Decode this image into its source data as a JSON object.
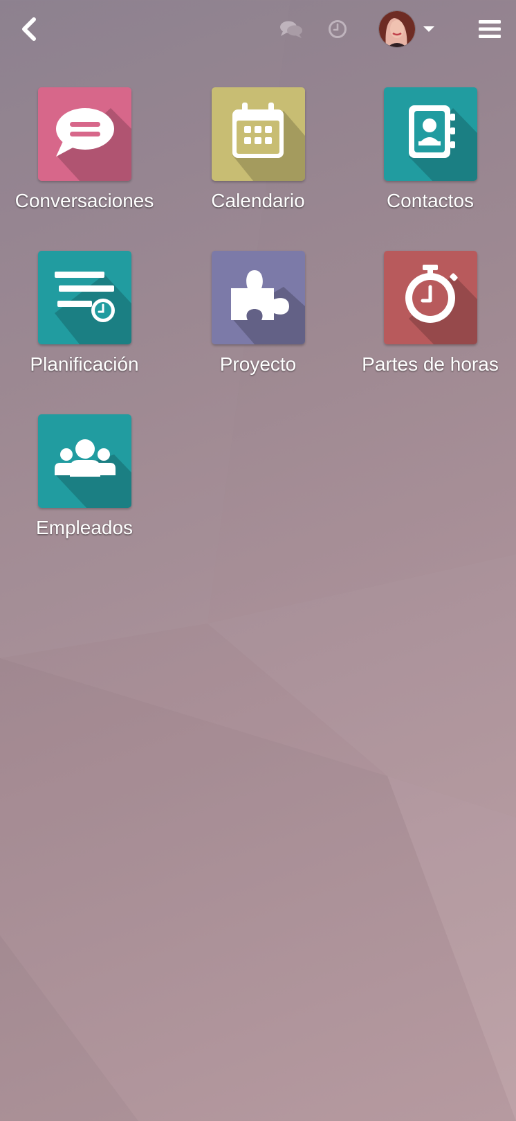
{
  "topbar": {
    "back_icon": "chevron-left-icon",
    "chat_icon": "comments-icon",
    "activity_icon": "clock-icon",
    "avatar_alt": "user-avatar",
    "menu_icon": "hamburger-icon"
  },
  "apps": [
    {
      "label": "Conversaciones",
      "icon": "chat-bubble-icon",
      "color": "#d7678a"
    },
    {
      "label": "Calendario",
      "icon": "calendar-icon",
      "color": "#c8bd73"
    },
    {
      "label": "Contactos",
      "icon": "address-book-icon",
      "color": "#219ca0"
    },
    {
      "label": "Planificación",
      "icon": "planning-list-clock-icon",
      "color": "#219ca0"
    },
    {
      "label": "Proyecto",
      "icon": "puzzle-piece-icon",
      "color": "#7c7aa8"
    },
    {
      "label": "Partes de horas",
      "icon": "stopwatch-icon",
      "color": "#b85a5c"
    },
    {
      "label": "Empleados",
      "icon": "users-group-icon",
      "color": "#219ca0"
    }
  ],
  "colors": {
    "text": "#ffffff",
    "background_start": "#8a7d8c",
    "background_end": "#bb9ea4"
  }
}
